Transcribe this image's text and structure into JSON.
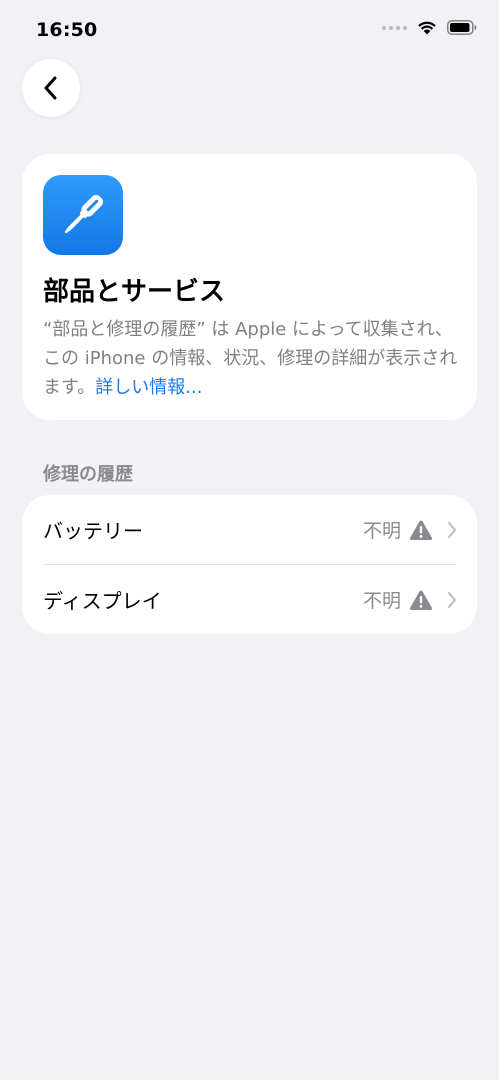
{
  "status_bar": {
    "time": "16:50"
  },
  "header": {
    "back_icon": "chevron-left-icon"
  },
  "info_card": {
    "icon": "screwdriver-icon",
    "title": "部品とサービス",
    "description": "“部品と修理の履歴” は Apple によって収集され、この iPhone の情報、状況、修理の詳細が表示されます。",
    "link_text": "詳しい情報..."
  },
  "repair_history": {
    "section_title": "修理の履歴",
    "items": [
      {
        "label": "バッテリー",
        "value": "不明",
        "status_icon": "warning-icon"
      },
      {
        "label": "ディスプレイ",
        "value": "不明",
        "status_icon": "warning-icon"
      }
    ]
  },
  "colors": {
    "background": "#F2F1F6",
    "card": "#FFFFFF",
    "accent": "#1A7CE8",
    "secondary_text": "#8A8A8F"
  }
}
